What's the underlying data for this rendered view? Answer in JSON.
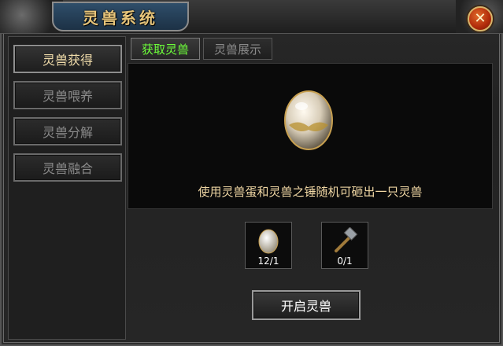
{
  "window": {
    "title": "灵兽系统",
    "close_symbol": "✕"
  },
  "sidebar": {
    "items": [
      {
        "label": "灵兽获得",
        "active": true
      },
      {
        "label": "灵兽喂养",
        "active": false
      },
      {
        "label": "灵兽分解",
        "active": false
      },
      {
        "label": "灵兽融合",
        "active": false
      }
    ]
  },
  "tabs": [
    {
      "label": "获取灵兽",
      "active": true
    },
    {
      "label": "灵兽展示",
      "active": false
    }
  ],
  "main": {
    "description": "使用灵兽蛋和灵兽之锤随机可砸出一只灵兽",
    "items": [
      {
        "icon": "beast-egg-icon",
        "count": "12/1"
      },
      {
        "icon": "beast-hammer-icon",
        "count": "0/1"
      }
    ],
    "action_label": "开启灵兽"
  },
  "colors": {
    "title": "#e6c47a",
    "active_tab": "#6dff3a",
    "description": "#f0d7a4"
  }
}
